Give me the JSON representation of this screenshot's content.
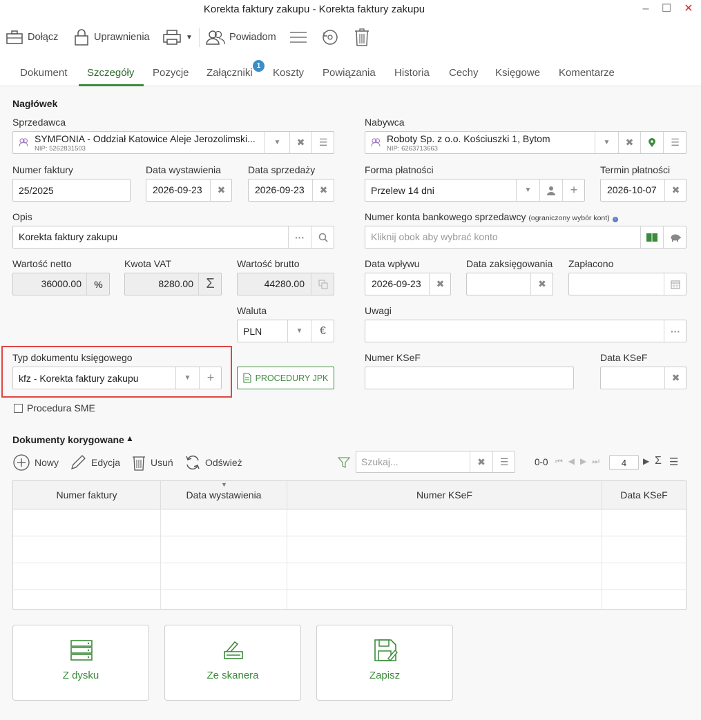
{
  "window": {
    "title": "Korekta faktury zakupu - Korekta faktury zakupu"
  },
  "toolbar": {
    "attach": "Dołącz",
    "permissions": "Uprawnienia",
    "notify": "Powiadom"
  },
  "tabs": [
    "Dokument",
    "Szczegóły",
    "Pozycje",
    "Załączniki",
    "Koszty",
    "Powiązania",
    "Historia",
    "Cechy",
    "Księgowe",
    "Komentarze"
  ],
  "tab_badge": "1",
  "header": {
    "section": "Nagłówek",
    "seller_label": "Sprzedawca",
    "seller_name": "SYMFONIA - Oddział Katowice Aleje Jerozolimski...",
    "seller_nip": "NIP: 5262831503",
    "buyer_label": "Nabywca",
    "buyer_name": "Roboty Sp. z o.o. Kościuszki 1, Bytom",
    "buyer_nip": "NIP: 6263713663",
    "invoice_no_label": "Numer faktury",
    "invoice_no": "25/2025",
    "issue_date_label": "Data wystawienia",
    "issue_date": "2026-09-23",
    "sale_date_label": "Data sprzedaży",
    "sale_date": "2026-09-23",
    "payment_form_label": "Forma płatności",
    "payment_form": "Przelew 14 dni",
    "payment_due_label": "Termin płatności",
    "payment_due": "2026-10-07",
    "desc_label": "Opis",
    "desc": "Korekta faktury zakupu",
    "bank_label": "Numer konta bankowego sprzedawcy",
    "bank_note": "(ograniczony wybór kont)",
    "bank_placeholder": "Kliknij obok aby wybrać konto",
    "net_label": "Wartość netto",
    "net": "36000.00",
    "vat_label": "Kwota VAT",
    "vat": "8280.00",
    "gross_label": "Wartość brutto",
    "gross": "44280.00",
    "receipt_date_label": "Data wpływu",
    "receipt_date": "2026-09-23",
    "posting_date_label": "Data zaksięgowania",
    "paid_label": "Zapłacono",
    "currency_label": "Waluta",
    "currency": "PLN",
    "notes_label": "Uwagi",
    "doc_type_label": "Typ dokumentu księgowego",
    "doc_type": "kfz - Korekta faktury zakupu",
    "jpk_button": "PROCEDURY JPK",
    "ksef_no_label": "Numer KSeF",
    "ksef_date_label": "Data KSeF",
    "sme_label": "Procedura SME"
  },
  "corrected": {
    "section": "Dokumenty korygowane",
    "new": "Nowy",
    "edit": "Edycja",
    "delete": "Usuń",
    "refresh": "Odśwież",
    "search_placeholder": "Szukaj...",
    "range": "0-0",
    "page_size": "4",
    "columns": [
      "Numer faktury",
      "Data wystawienia",
      "Numer KSeF",
      "Data KSeF"
    ]
  },
  "bottom": {
    "from_disk": "Z dysku",
    "from_scanner": "Ze skanera",
    "save": "Zapisz"
  },
  "colors": {
    "accent_green": "#3c8a3c",
    "highlight_red": "#e04545",
    "badge_blue": "#3a8ec8"
  }
}
